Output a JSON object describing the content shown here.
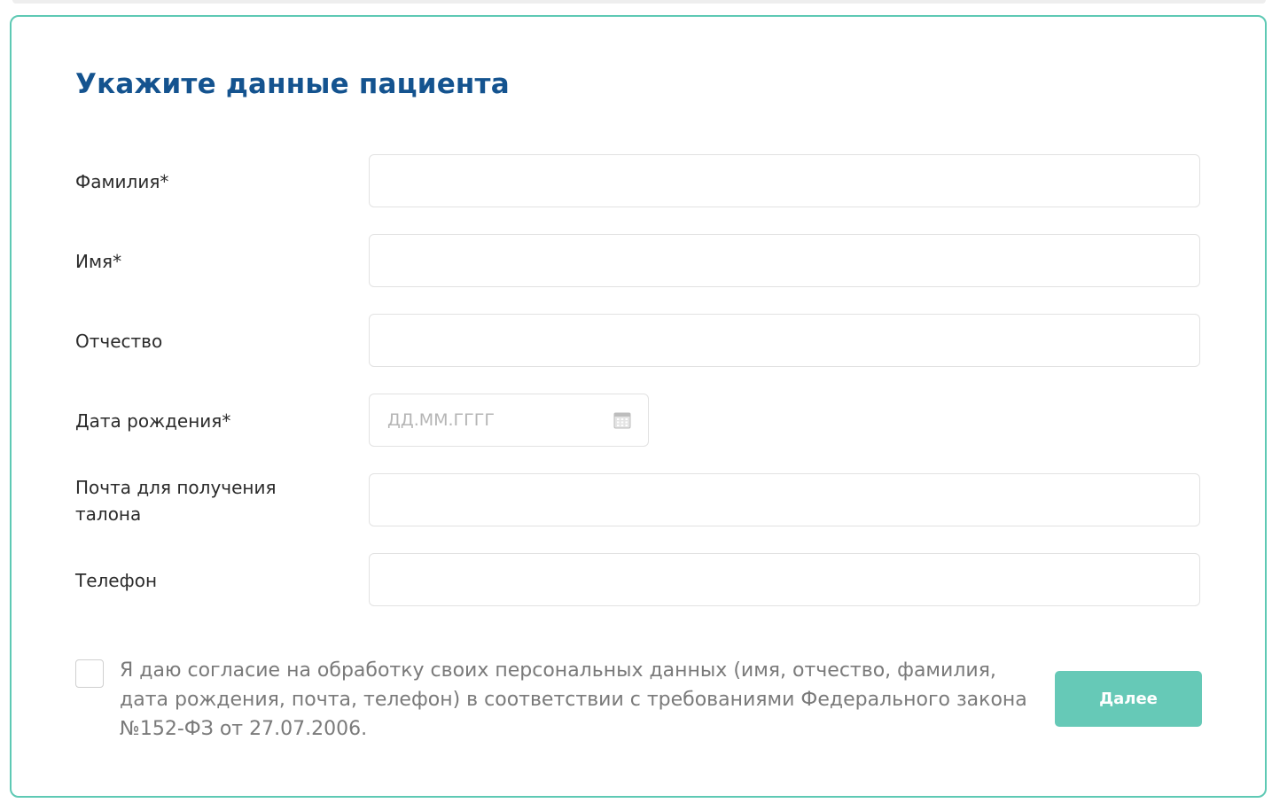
{
  "form": {
    "title": "Укажите данные пациента",
    "fields": [
      {
        "label": "Фамилия*",
        "value": ""
      },
      {
        "label": "Имя*",
        "value": ""
      },
      {
        "label": "Отчество",
        "value": ""
      },
      {
        "label": "Дата рождения*",
        "placeholder": "ДД.ММ.ГГГГ",
        "icon": "calendar-icon"
      },
      {
        "label": "Почта для получения талона",
        "value": ""
      },
      {
        "label": "Телефон",
        "value": ""
      }
    ],
    "consent": {
      "checked": false,
      "text": "Я даю согласие на обработку своих персональных данных (имя, отчество, фамилия, дата рождения, почта, телефон) в соответствии с требованиями Федерального закона №152-ФЗ от 27.07.2006."
    },
    "next_label": "Далее"
  },
  "colors": {
    "title": "#14538f",
    "border_accent": "#5ec9b4",
    "button": "#66c9b7",
    "placeholder": "#b5b5b5"
  }
}
